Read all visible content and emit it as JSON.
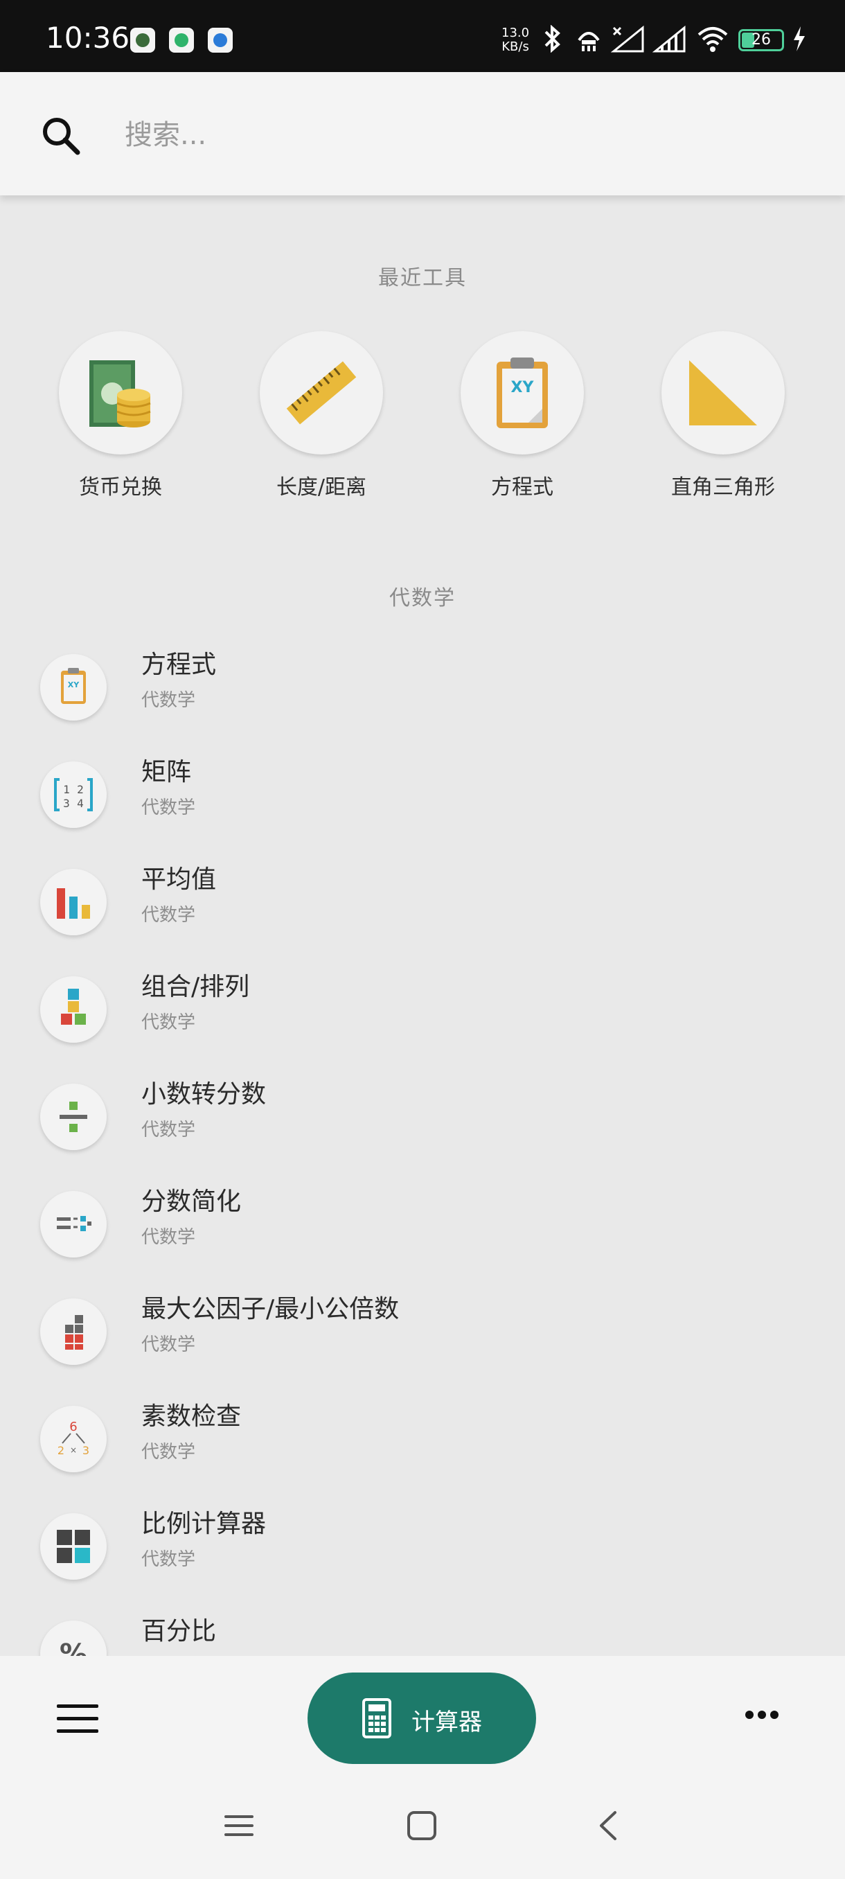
{
  "status_bar": {
    "time": "10:36",
    "net_speed_value": "13.0",
    "net_speed_unit": "KB/s",
    "battery": "26"
  },
  "search": {
    "placeholder": "搜索..."
  },
  "recent": {
    "title": "最近工具",
    "items": [
      {
        "label": "货币兑换",
        "icon": "currency-icon"
      },
      {
        "label": "长度/距离",
        "icon": "ruler-icon"
      },
      {
        "label": "方程式",
        "icon": "clipboard-xy-icon"
      },
      {
        "label": "直角三角形",
        "icon": "right-triangle-icon"
      }
    ]
  },
  "algebra": {
    "title": "代数学",
    "items": [
      {
        "title": "方程式",
        "sub": "代数学",
        "icon": "clipboard-xy-icon"
      },
      {
        "title": "矩阵",
        "sub": "代数学",
        "icon": "matrix-icon"
      },
      {
        "title": "平均值",
        "sub": "代数学",
        "icon": "bar-chart-icon"
      },
      {
        "title": "组合/排列",
        "sub": "代数学",
        "icon": "blocks-icon"
      },
      {
        "title": "小数转分数",
        "sub": "代数学",
        "icon": "divide-icon"
      },
      {
        "title": "分数简化",
        "sub": "代数学",
        "icon": "fraction-simplify-icon"
      },
      {
        "title": "最大公因子/最小公倍数",
        "sub": "代数学",
        "icon": "gcd-lcm-icon"
      },
      {
        "title": "素数检查",
        "sub": "代数学",
        "icon": "prime-tree-icon"
      },
      {
        "title": "比例计算器",
        "sub": "代数学",
        "icon": "ratio-grid-icon"
      },
      {
        "title": "百分比",
        "sub": "",
        "icon": "percent-icon"
      }
    ]
  },
  "bottom": {
    "calculator_label": "计算器"
  },
  "colors": {
    "accent": "#1d7a6a",
    "background": "#e9e9e9"
  }
}
